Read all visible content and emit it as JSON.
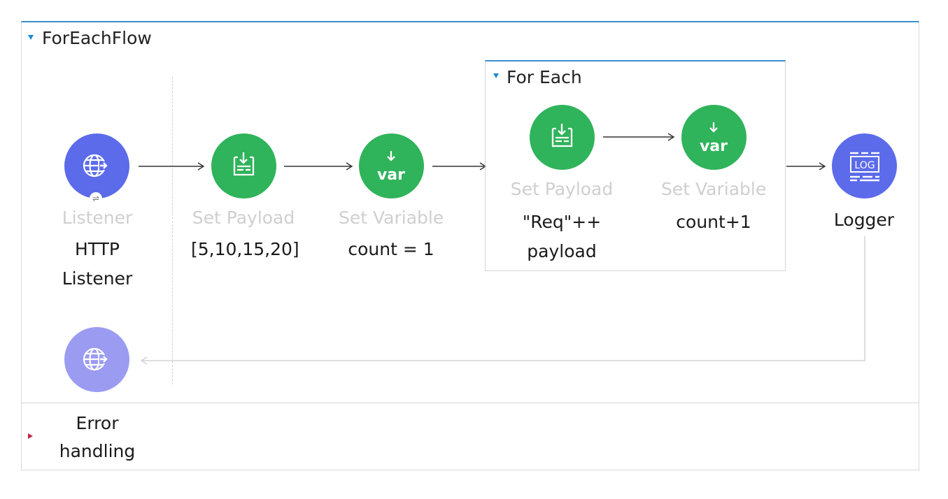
{
  "flow": {
    "title": "ForEachFlow",
    "source": {
      "icon": "http-globe-icon",
      "type_label": "Listener",
      "display_name": "HTTP\nListener"
    },
    "processors": [
      {
        "icon": "set-payload-icon",
        "type_label": "Set Payload",
        "display_name": "[5,10,15,20]"
      },
      {
        "icon": "set-variable-icon",
        "type_label": "Set Variable",
        "display_name": "count = 1",
        "glyph": "var"
      }
    ],
    "for_each": {
      "title": "For Each",
      "processors": [
        {
          "icon": "set-payload-icon",
          "type_label": "Set Payload",
          "display_name": "\"Req\"++\npayload"
        },
        {
          "icon": "set-variable-icon",
          "type_label": "Set Variable",
          "display_name": "count+1",
          "glyph": "var"
        }
      ]
    },
    "logger": {
      "icon": "logger-icon",
      "display_name": "Logger",
      "glyph": "LOG"
    },
    "response": {
      "icon": "http-globe-icon"
    },
    "error_handling": {
      "label": "Error\nhandling"
    }
  },
  "colors": {
    "processor_green": "#2fb35b",
    "connector_purple": "#5b6bea",
    "response_purple": "#9a9bf1",
    "accent_blue": "#3a8fd0"
  }
}
